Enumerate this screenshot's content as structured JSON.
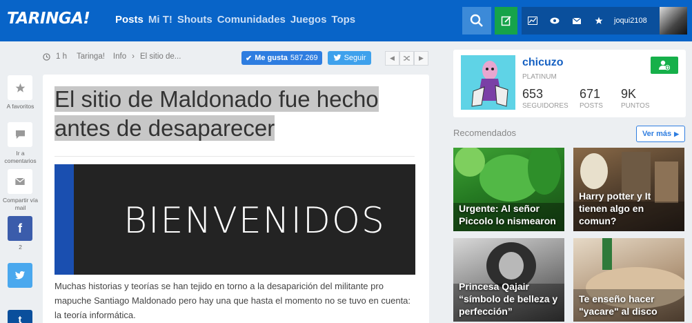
{
  "header": {
    "logo": "TARINGA!",
    "nav": [
      "Posts",
      "Mi T!",
      "Shouts",
      "Comunidades",
      "Juegos",
      "Tops"
    ],
    "username": "joqui2108",
    "colors": {
      "bar": "#0864c8",
      "search": "#3c8ad8",
      "post": "#16a34a"
    }
  },
  "meta": {
    "time": "1 h",
    "crumbs": [
      "Taringa!",
      "Info",
      "El sitio de..."
    ],
    "like_label": "Me gusta",
    "like_count": "587.269",
    "follow_label": "Seguir"
  },
  "sidebar": {
    "favorites": "A favoritos",
    "go_comments": "Ir a comentarios",
    "share_mail": "Compartir vía mail",
    "fb_count": "2",
    "fb_icon": "f",
    "tw_icon": "t",
    "tumblr_icon": "t"
  },
  "article": {
    "title_line1": "El sitio de Maldonado fue hecho",
    "title_line2": "antes de desaparecer",
    "banner_text": "BIENVENIDOS",
    "body": "Muchas historias y teorías se han tejido en torno a la desaparición del militante pro mapuche Santiago Maldonado pero hay una que hasta el momento no se tuvo en cuenta: la teoría informática."
  },
  "profile": {
    "name": "chicuzo",
    "rank": "PLATINUM",
    "stats": [
      {
        "value": "653",
        "label": "SEGUIDORES"
      },
      {
        "value": "671",
        "label": "POSTS"
      },
      {
        "value": "9K",
        "label": "PUNTOS"
      }
    ]
  },
  "recommended": {
    "title": "Recomendados",
    "more": "Ver más",
    "items": [
      {
        "caption": "Urgente: Al señor Piccolo lo nismearon"
      },
      {
        "caption": "Harry potter y It tienen algo en comun?"
      },
      {
        "caption": "Princesa Qajair “símbolo de belleza y perfección”"
      },
      {
        "caption": "Te enseño hacer \"yacare\" al disco"
      }
    ]
  }
}
